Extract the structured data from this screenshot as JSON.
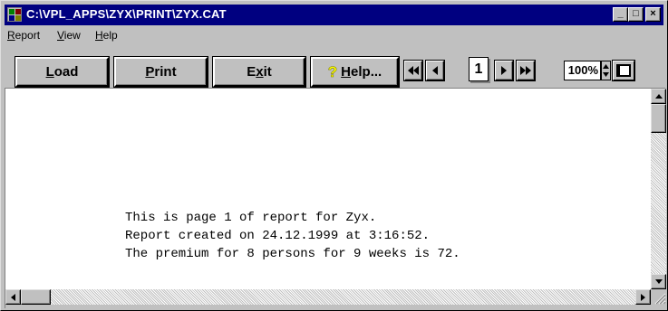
{
  "window": {
    "title": "C:\\VPL_APPS\\ZYX\\PRINT\\ZYX.CAT",
    "controls": {
      "minimize": "_",
      "maximize": "□",
      "close": "×"
    }
  },
  "menu": {
    "report": {
      "accel": "R",
      "rest": "eport"
    },
    "view": {
      "accel": "V",
      "rest": "iew"
    },
    "help": {
      "accel": "H",
      "rest": "elp"
    }
  },
  "toolbar": {
    "load": {
      "accel": "L",
      "rest": "oad"
    },
    "print": {
      "accel": "P",
      "rest": "rint"
    },
    "exit": {
      "pre": "E",
      "accel": "x",
      "rest": "it"
    },
    "help": {
      "accel": "H",
      "rest": "elp..."
    },
    "page": "1",
    "zoom": "100%"
  },
  "report": {
    "lines": [
      "This is page 1 of report for Zyx.",
      "Report created on 24.12.1999 at 3:16:52.",
      "The premium for 8 persons for 9 weeks is 72."
    ]
  },
  "icons": {
    "app": "app-icon",
    "help": "question-icon",
    "first": "first-page-icon",
    "prev": "prev-page-icon",
    "next": "next-page-icon",
    "last": "last-page-icon",
    "fit": "fit-page-icon"
  },
  "colors": {
    "titlebar": "#000080",
    "face": "#c0c0c0",
    "page": "#ffffff",
    "help_icon": "#ffff00"
  }
}
